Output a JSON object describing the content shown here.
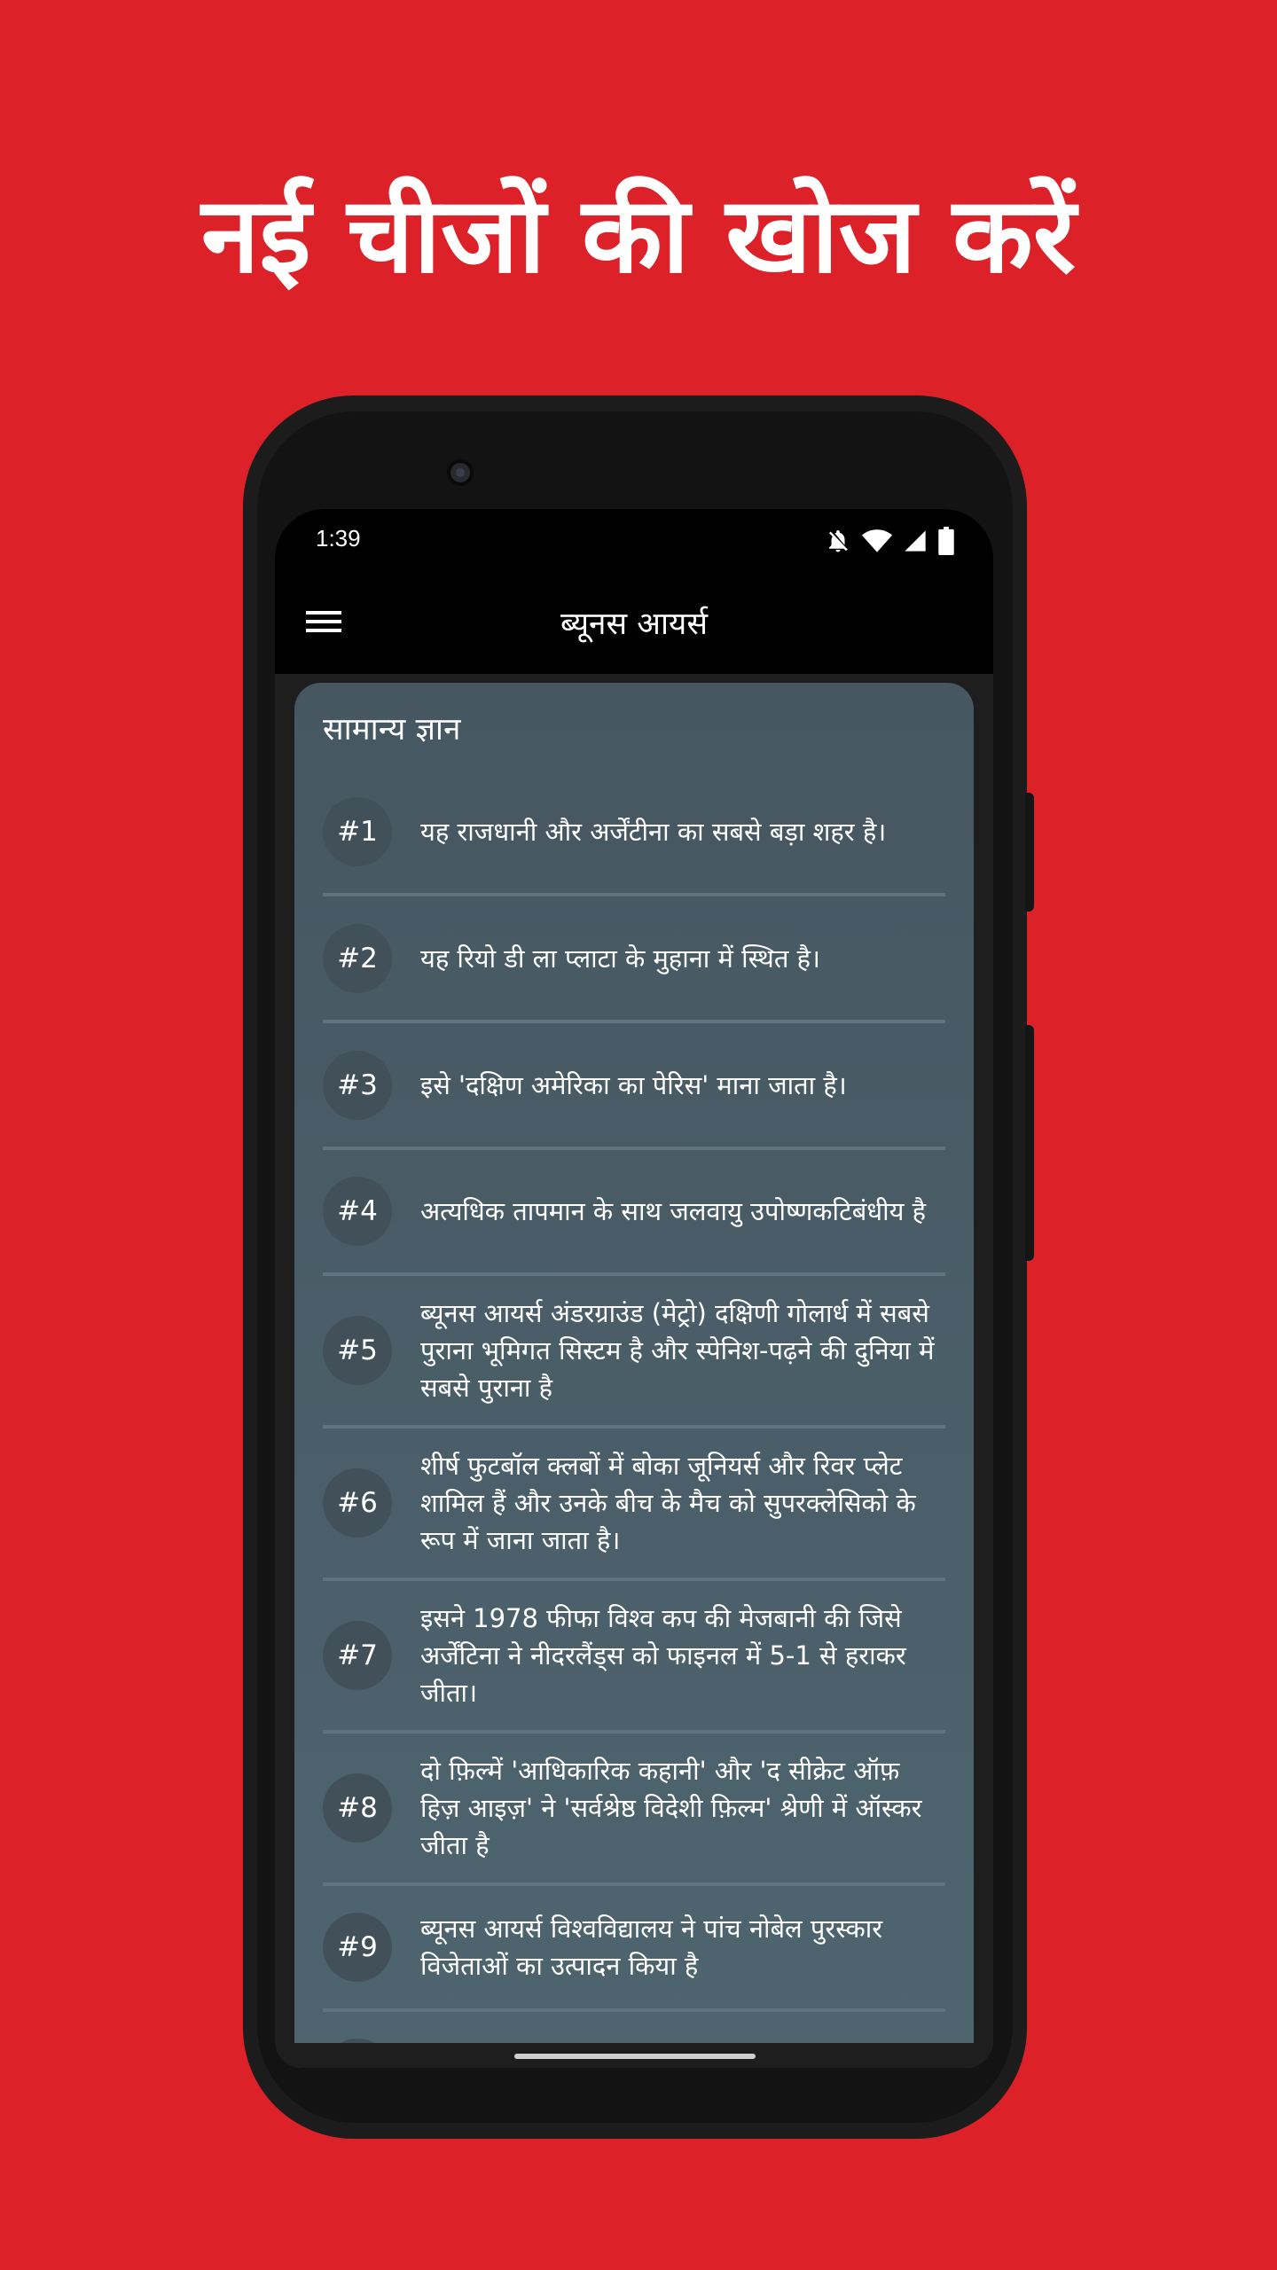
{
  "headline": "नई चीजों की खोज करें",
  "status": {
    "time": "1:39"
  },
  "appbar": {
    "title": "ब्यूनस आयर्स"
  },
  "card": {
    "title": "सामान्य ज्ञान",
    "facts": [
      {
        "num": "#1",
        "text": "यह राजधानी और अर्जेंटीना का सबसे बड़ा शहर है।"
      },
      {
        "num": "#2",
        "text": "यह रियो डी ला प्लाटा के मुहाना में स्थित है।"
      },
      {
        "num": "#3",
        "text": "इसे 'दक्षिण अमेरिका का पेरिस' माना जाता है।"
      },
      {
        "num": "#4",
        "text": "अत्यधिक तापमान के साथ जलवायु उपोष्णकटिबंधीय है"
      },
      {
        "num": "#5",
        "text": "ब्यूनस आयर्स अंडरग्राउंड (मेट्रो) दक्षिणी गोलार्ध में सबसे पुराना भूमिगत सिस्टम है और स्पेनिश-पढ़ने की दुनिया में सबसे पुराना है"
      },
      {
        "num": "#6",
        "text": "शीर्ष फुटबॉल क्लबों में बोका जूनियर्स और रिवर प्लेट शामिल हैं और उनके बीच के मैच को सुपरक्लेसिको के रूप में जाना जाता है।"
      },
      {
        "num": "#7",
        "text": "इसने 1978 फीफा विश्व कप की मेजबानी की जिसे अर्जेंटिना ने नीदरलैंड्स को फाइनल में 5-1 से हराकर जीता।"
      },
      {
        "num": "#8",
        "text": "दो फ़िल्में 'आधिकारिक कहानी' और 'द सीक्रेट ऑफ़ हिज़ आइज़' ने 'सर्वश्रेष्ठ विदेशी फ़िल्म' श्रेणी में ऑस्कर जीता है"
      },
      {
        "num": "#9",
        "text": "ब्यूनस आयर्स विश्वविद्यालय ने पांच नोबेल पुरस्कार विजेताओं का उत्पादन किया है"
      }
    ]
  },
  "icons": {
    "menu": "hamburger-menu-icon",
    "notifications_off": "bell-off-icon",
    "wifi": "wifi-icon",
    "signal": "cellular-signal-icon",
    "battery": "battery-icon"
  },
  "colors": {
    "background": "#dc2128",
    "card": "#4b5f69",
    "badge": "#425159",
    "appbar": "#000000"
  }
}
